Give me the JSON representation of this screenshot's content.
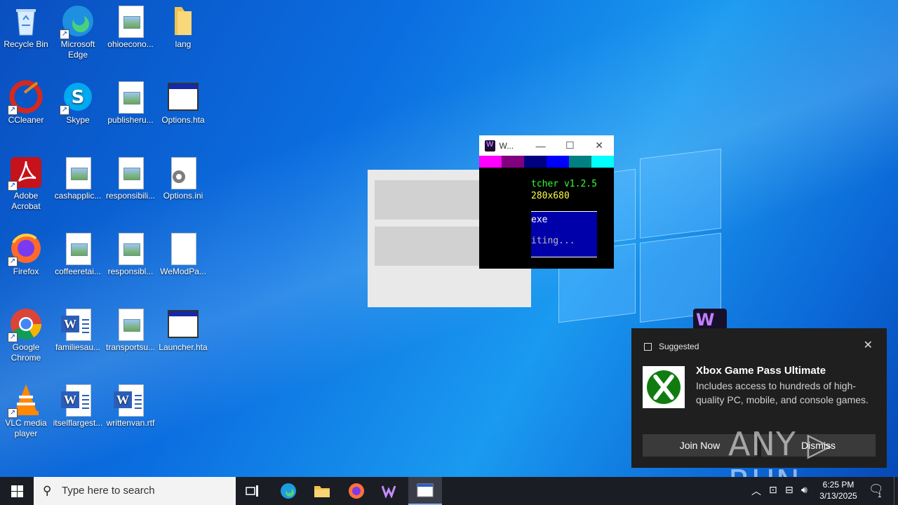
{
  "desktop_icons": [
    {
      "label": "Recycle Bin",
      "icon": "recycle-bin-icon"
    },
    {
      "label": "Microsoft Edge",
      "icon": "edge-icon"
    },
    {
      "label": "ohioecono...",
      "icon": "image-file-icon"
    },
    {
      "label": "lang",
      "icon": "folder-icon"
    },
    {
      "label": "CCleaner",
      "icon": "ccleaner-icon"
    },
    {
      "label": "Skype",
      "icon": "skype-icon"
    },
    {
      "label": "publisheru...",
      "icon": "image-file-icon"
    },
    {
      "label": "Options.hta",
      "icon": "hta-file-icon"
    },
    {
      "label": "Adobe Acrobat",
      "icon": "acrobat-icon"
    },
    {
      "label": "cashapplic...",
      "icon": "image-file-icon"
    },
    {
      "label": "responsibili...",
      "icon": "image-file-icon"
    },
    {
      "label": "Options.ini",
      "icon": "ini-settings-file-icon"
    },
    {
      "label": "Firefox",
      "icon": "firefox-icon"
    },
    {
      "label": "coffeeretai...",
      "icon": "image-file-icon"
    },
    {
      "label": "responsibl...",
      "icon": "image-file-icon"
    },
    {
      "label": "WeModPa...",
      "icon": "blank-file-icon"
    },
    {
      "label": "Google Chrome",
      "icon": "chrome-icon"
    },
    {
      "label": "familiesau...",
      "icon": "word-document-icon"
    },
    {
      "label": "transportsu...",
      "icon": "image-file-icon"
    },
    {
      "label": "Launcher.hta",
      "icon": "hta-file-icon"
    },
    {
      "label": "VLC media player",
      "icon": "vlc-icon"
    },
    {
      "label": "itselflargest...",
      "icon": "word-document-icon"
    },
    {
      "label": "writtenvan.rtf",
      "icon": "word-document-icon"
    }
  ],
  "launcher_window": {
    "title": "W...",
    "minimize": "—",
    "maximize": "☐",
    "close": "✕",
    "color_strip": [
      "#ff00ff",
      "#800080",
      "#000080",
      "#0000ff",
      "#008080",
      "#00ffff"
    ],
    "line1": "tcher v1.2.5",
    "line2": "280x680",
    "box_line1": "exe",
    "box_line2": "iting..."
  },
  "toast": {
    "header": "Suggested",
    "close": "✕",
    "title": "Xbox Game Pass Ultimate",
    "description": "Includes access to hundreds of high-quality PC, mobile, and console games.",
    "primary_button": "Join Now",
    "secondary_button": "Dismiss"
  },
  "watermark": "ANY ▷ RUN",
  "taskbar": {
    "search_placeholder": "Type here to search",
    "time": "6:25 PM",
    "date": "3/13/2025",
    "notification_count": "1"
  }
}
